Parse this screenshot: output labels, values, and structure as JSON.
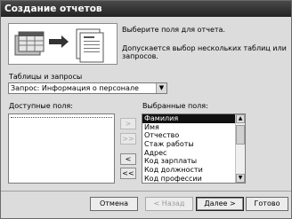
{
  "window": {
    "title": "Создание отчетов"
  },
  "intro": {
    "line1": "Выберите поля для отчета.",
    "line2": "Допускается выбор нескольких таблиц или запросов."
  },
  "tables": {
    "label": "Таблицы и запросы",
    "selected": "Запрос: Информация о персонале"
  },
  "available": {
    "label": "Доступные поля:",
    "items": []
  },
  "selected_fields": {
    "label": "Выбранные поля:",
    "items": [
      "Фамилия",
      "Имя",
      "Отчество",
      "Стаж работы",
      "Адрес",
      "Код зарплаты",
      "Код должности",
      "Код профессии"
    ],
    "highlighted_index": 0
  },
  "move_buttons": {
    "add_one": ">",
    "add_all": ">>",
    "remove_one": "<",
    "remove_all": "<<"
  },
  "footer": {
    "cancel": "Отмена",
    "back": "< Назад",
    "next": "Далее >",
    "finish": "Готово"
  }
}
